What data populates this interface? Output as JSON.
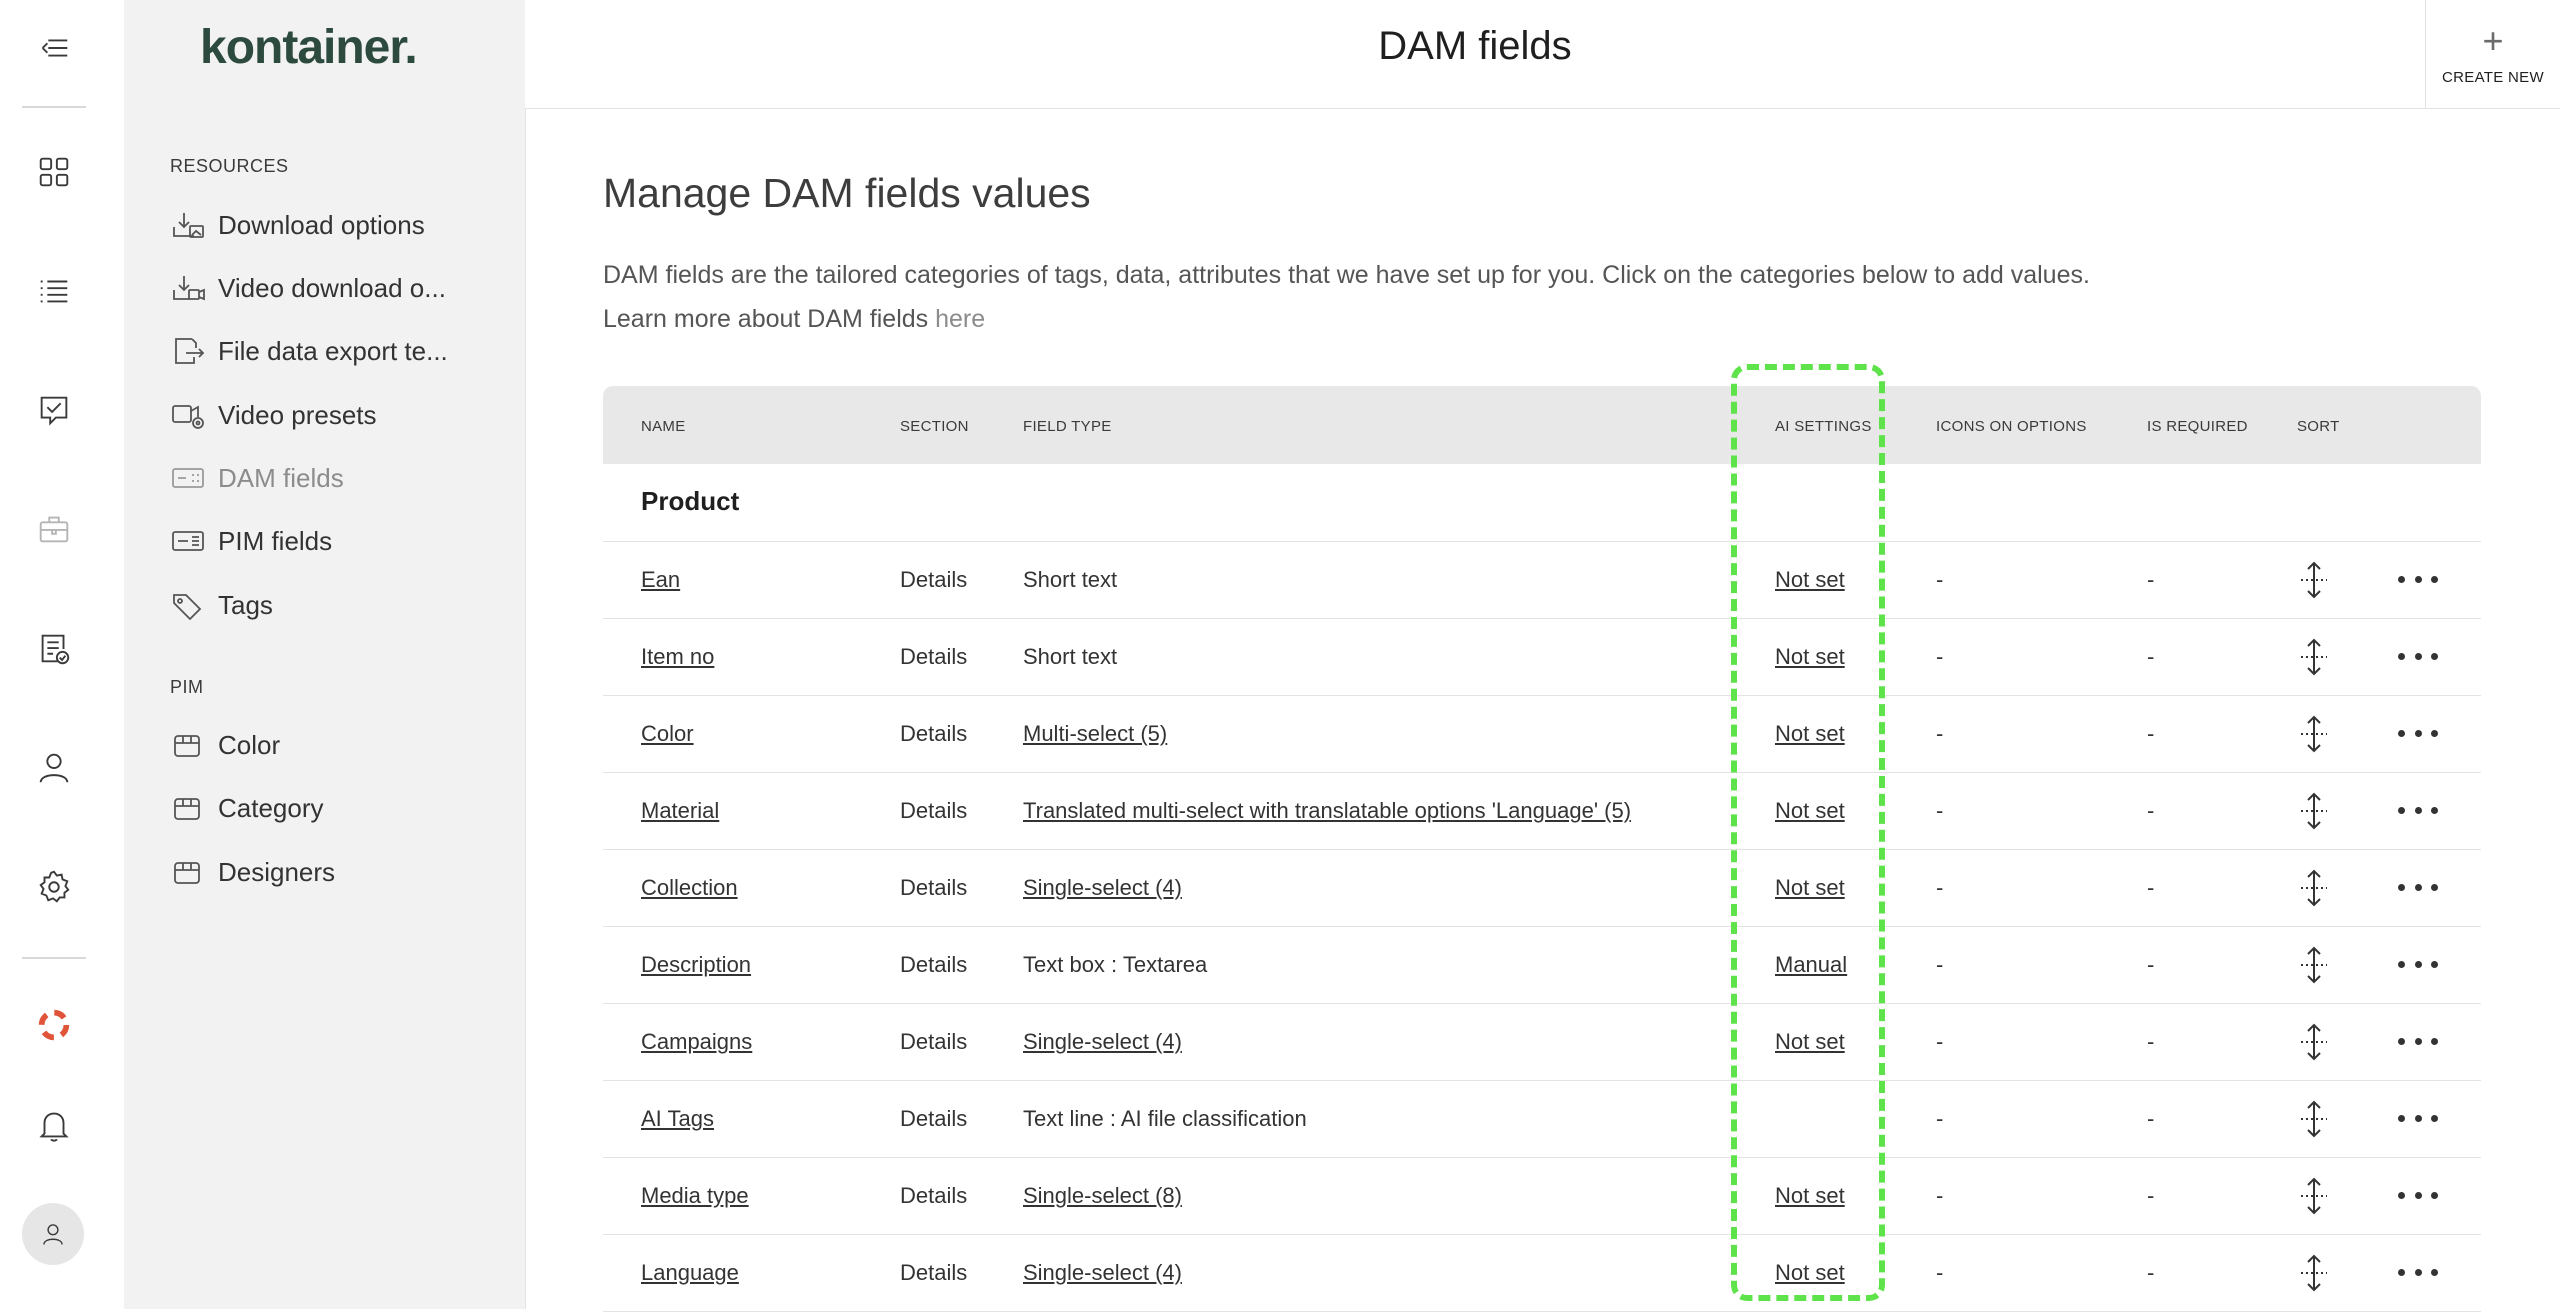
{
  "rail": {
    "items": [
      "collapse-menu-icon",
      "grid-icon",
      "list-icon",
      "tasks-icon",
      "briefcase-icon",
      "report-icon",
      "user-icon",
      "gear-icon",
      "help-lifebuoy-icon",
      "bell-icon",
      "avatar-icon"
    ]
  },
  "sidebar": {
    "logo": "kontainer.",
    "resources_label": "RESOURCES",
    "resources": [
      {
        "label": "Download options",
        "icon": "download-image-icon"
      },
      {
        "label": "Video download o...",
        "icon": "download-video-icon"
      },
      {
        "label": "File data export te...",
        "icon": "file-export-icon"
      },
      {
        "label": "Video presets",
        "icon": "video-preset-icon"
      },
      {
        "label": "DAM fields",
        "icon": "dam-fields-icon",
        "active": true
      },
      {
        "label": "PIM fields",
        "icon": "pim-fields-icon"
      },
      {
        "label": "Tags",
        "icon": "tag-icon"
      }
    ],
    "pim_label": "PIM",
    "pim": [
      {
        "label": "Color",
        "icon": "box-icon"
      },
      {
        "label": "Category",
        "icon": "box-icon"
      },
      {
        "label": "Designers",
        "icon": "box-icon"
      }
    ]
  },
  "header": {
    "title": "DAM fields",
    "create_new": "CREATE NEW"
  },
  "main": {
    "heading": "Manage DAM fields values",
    "description": "DAM fields are the tailored categories of tags, data, attributes that we have set up for you. Click on the categories below to add values.",
    "learn_more": "Learn more about DAM fields",
    "here": "here"
  },
  "table": {
    "columns": {
      "name": "NAME",
      "section": "SECTION",
      "field_type": "FIELD TYPE",
      "ai_settings": "AI SETTINGS",
      "icons_on_options": "ICONS ON OPTIONS",
      "is_required": "IS REQUIRED",
      "sort": "SORT"
    },
    "group": "Product",
    "rows": [
      {
        "name": "Ean",
        "section": "Details",
        "field_type": "Short text",
        "field_type_link": false,
        "ai": "Not set",
        "icons": "-",
        "required": "-"
      },
      {
        "name": "Item no",
        "section": "Details",
        "field_type": "Short text",
        "field_type_link": false,
        "ai": "Not set",
        "icons": "-",
        "required": "-"
      },
      {
        "name": "Color",
        "section": "Details",
        "field_type": "Multi-select (5)",
        "field_type_link": true,
        "ai": "Not set",
        "icons": "-",
        "required": "-"
      },
      {
        "name": "Material",
        "section": "Details",
        "field_type": "Translated multi-select with translatable options 'Language' (5)",
        "field_type_link": true,
        "ai": "Not set",
        "icons": "-",
        "required": "-"
      },
      {
        "name": "Collection",
        "section": "Details",
        "field_type": "Single-select (4)",
        "field_type_link": true,
        "ai": "Not set",
        "icons": "-",
        "required": "-"
      },
      {
        "name": "Description",
        "section": "Details",
        "field_type": "Text box : Textarea",
        "field_type_link": false,
        "ai": "Manual",
        "icons": "-",
        "required": "-"
      },
      {
        "name": "Campaigns",
        "section": "Details",
        "field_type": "Single-select (4)",
        "field_type_link": true,
        "ai": "Not set",
        "icons": "-",
        "required": "-"
      },
      {
        "name": "AI Tags",
        "section": "Details",
        "field_type": "Text line : AI file classification",
        "field_type_link": false,
        "ai": "",
        "icons": "-",
        "required": "-"
      },
      {
        "name": "Media type",
        "section": "Details",
        "field_type": "Single-select (8)",
        "field_type_link": true,
        "ai": "Not set",
        "icons": "-",
        "required": "-"
      },
      {
        "name": "Language",
        "section": "Details",
        "field_type": "Single-select (4)",
        "field_type_link": true,
        "ai": "Not set",
        "icons": "-",
        "required": "-"
      }
    ]
  },
  "colors": {
    "highlight": "#5fe34a",
    "logo": "#2c4a3e",
    "help_icon": "#e0553a"
  }
}
